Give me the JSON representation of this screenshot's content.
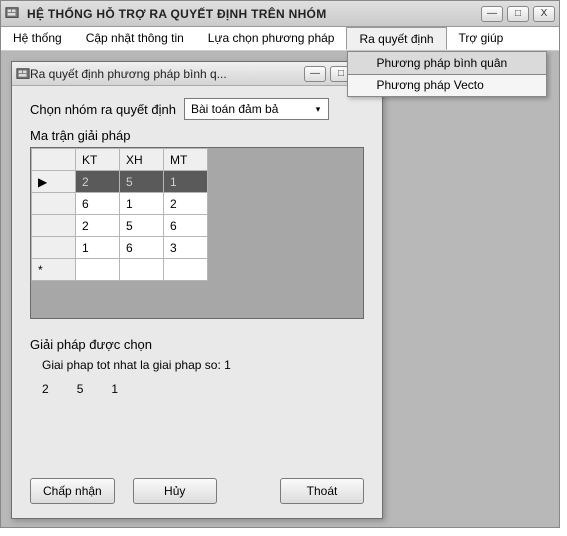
{
  "main_window": {
    "title": "HỆ THỐNG HỖ TRỢ RA QUYẾT ĐỊNH TRÊN NHÓM",
    "controls": {
      "min": "—",
      "max": "□",
      "close": "X"
    }
  },
  "menubar": {
    "items": [
      {
        "label": "Hệ thống"
      },
      {
        "label": "Cập nhật thông tin"
      },
      {
        "label": "Lựa chọn phương pháp"
      },
      {
        "label": "Ra quyết định"
      },
      {
        "label": "Trợ giúp"
      }
    ],
    "open_index": 3,
    "dropdown": [
      {
        "label": "Phương pháp bình quân"
      },
      {
        "label": "Phương pháp Vecto"
      }
    ],
    "dropdown_highlight": 0
  },
  "child_window": {
    "title": "Ra quyết định phương pháp bình q...",
    "controls": {
      "min": "—",
      "max": "□",
      "close": "X"
    }
  },
  "form": {
    "group_label": "Chọn nhóm ra quyết định",
    "group_value": "Bài toán đảm bả",
    "matrix_label": "Ma trận giải pháp"
  },
  "grid": {
    "columns": [
      "KT",
      "XH",
      "MT"
    ],
    "rows": [
      {
        "selected": true,
        "marker": "▶",
        "cells": [
          "2",
          "5",
          "1"
        ]
      },
      {
        "selected": false,
        "marker": "",
        "cells": [
          "6",
          "1",
          "2"
        ]
      },
      {
        "selected": false,
        "marker": "",
        "cells": [
          "2",
          "5",
          "6"
        ]
      },
      {
        "selected": false,
        "marker": "",
        "cells": [
          "1",
          "6",
          "3"
        ]
      }
    ],
    "new_row_marker": "*"
  },
  "result": {
    "label": "Giải pháp được chọn",
    "line": "Giai phap tot nhat la giai phap so: 1",
    "values": [
      "2",
      "5",
      "1"
    ]
  },
  "buttons": {
    "accept": "Chấp nhận",
    "cancel": "Hủy",
    "exit": "Thoát"
  }
}
